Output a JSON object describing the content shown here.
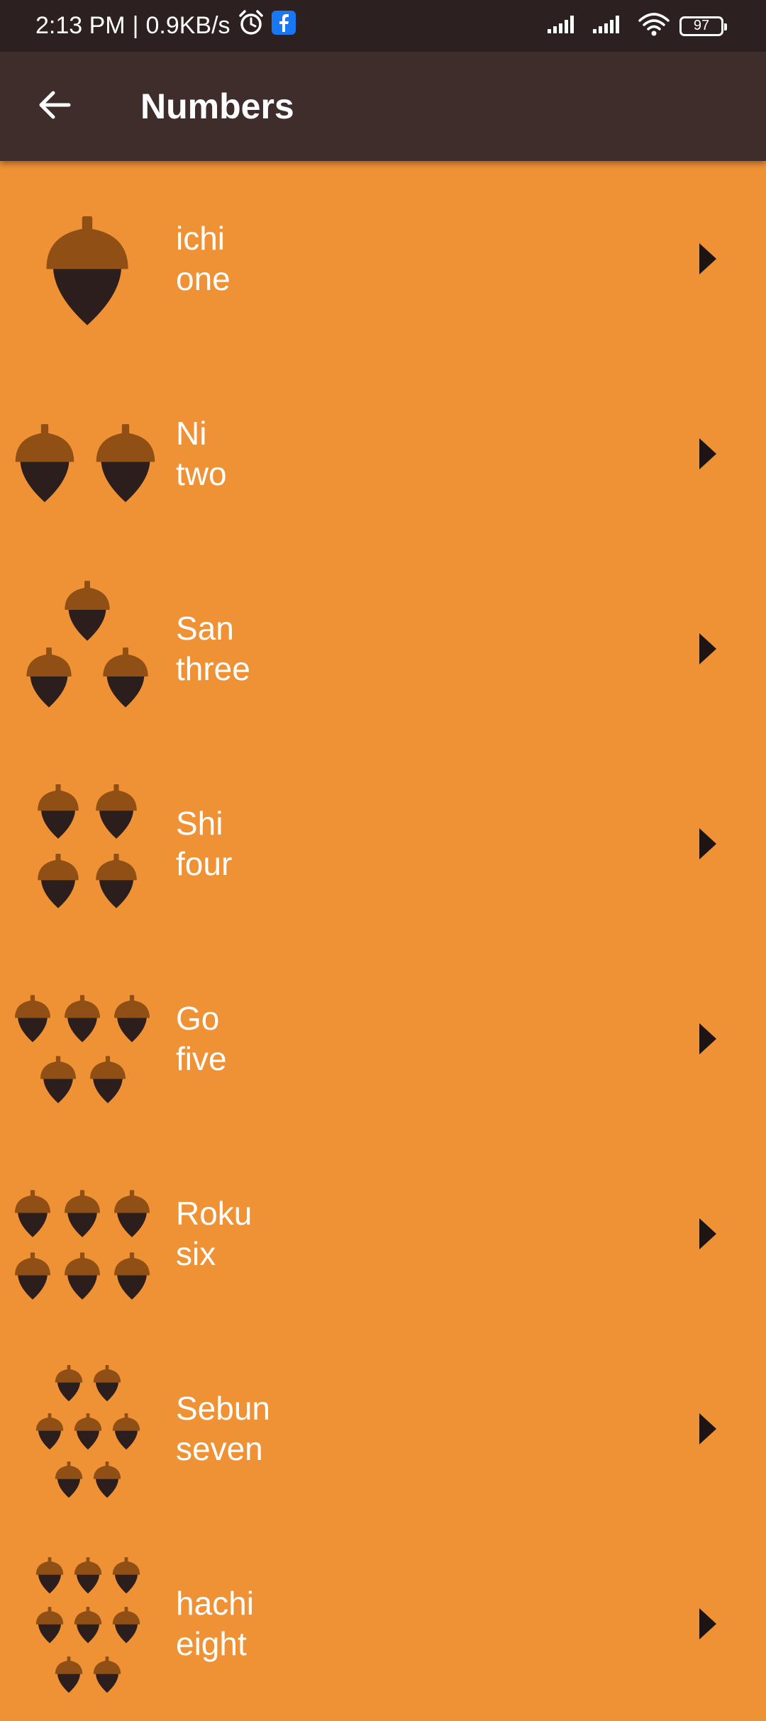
{
  "status_bar": {
    "time": "2:13 PM",
    "separator": "|",
    "network_speed": "0.9KB/s",
    "battery": "97",
    "icons": [
      "alarm-icon",
      "facebook-icon",
      "signal-icon",
      "signal-icon",
      "wifi-icon",
      "battery-icon"
    ]
  },
  "app_bar": {
    "back_icon": "arrow-left-icon",
    "title": "Numbers"
  },
  "colors": {
    "background": "#EF9235",
    "app_bar": "#3F2D2C",
    "status_bar": "#2D2020",
    "acorn_cap": "#8F4F15",
    "acorn_body": "#2D1E1E",
    "play_icon": "#1E1414"
  },
  "items": [
    {
      "japanese": "ichi",
      "english": "one",
      "count": 1
    },
    {
      "japanese": "Ni",
      "english": "two",
      "count": 2
    },
    {
      "japanese": "San",
      "english": "three",
      "count": 3
    },
    {
      "japanese": "Shi",
      "english": "four",
      "count": 4
    },
    {
      "japanese": "Go",
      "english": "five",
      "count": 5
    },
    {
      "japanese": "Roku",
      "english": "six",
      "count": 6
    },
    {
      "japanese": "Sebun",
      "english": "seven",
      "count": 7
    },
    {
      "japanese": "hachi",
      "english": "eight",
      "count": 8
    }
  ]
}
